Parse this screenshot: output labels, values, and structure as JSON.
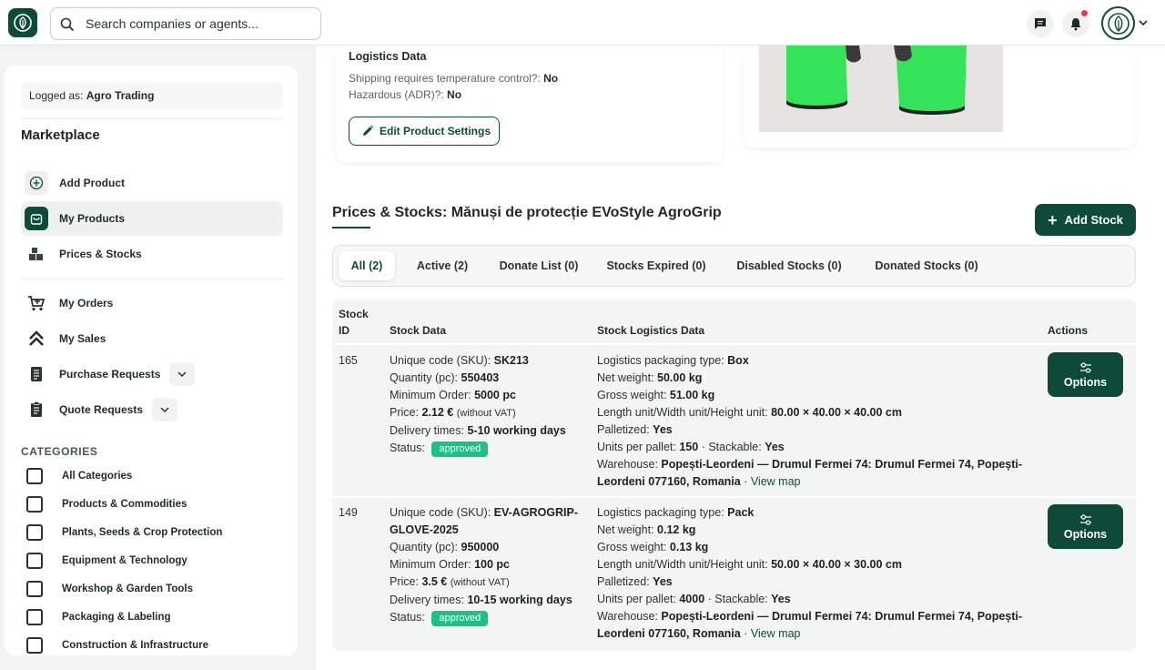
{
  "header": {
    "search_placeholder": "Search companies or agents...",
    "icons": [
      "logo-icon",
      "search-icon",
      "chat-icon",
      "bell-icon",
      "avatar",
      "chevron-down-icon"
    ]
  },
  "sidebar": {
    "logged_label": "Logged as:",
    "logged_company": "Agro Trading",
    "title": "Marketplace",
    "nav": [
      {
        "label": "Add Product",
        "icon": "plus-circle-icon"
      },
      {
        "label": "My Products",
        "icon": "bag-icon",
        "active": true
      },
      {
        "label": "Prices & Stocks",
        "icon": "boxes-icon"
      },
      {
        "label": "My Orders",
        "icon": "cart-icon"
      },
      {
        "label": "My Sales",
        "icon": "chevrons-up-icon"
      },
      {
        "label": "Purchase Requests",
        "icon": "document-icon"
      },
      {
        "label": "Quote Requests",
        "icon": "clipboard-icon"
      }
    ],
    "categories_heading": "CATEGORIES",
    "categories": [
      "All Categories",
      "Products & Commodities",
      "Plants, Seeds & Crop Protection",
      "Equipment & Technology",
      "Workshop & Garden Tools",
      "Packaging & Labeling",
      "Construction & Infrastructure"
    ]
  },
  "logistics": {
    "title": "Logistics Data",
    "temp_label": "Shipping requires temperature control?:",
    "temp_value": "No",
    "hazard_label": "Hazardous (ADR)?:",
    "hazard_value": "No",
    "edit_button": "Edit Product Settings"
  },
  "stocks": {
    "title": "Prices & Stocks: Mănuși de protecție EVoStyle AgroGrip",
    "add_button": "Add Stock",
    "tabs": [
      {
        "label": "All (2)",
        "active": true
      },
      {
        "label": "Active (2)"
      },
      {
        "label": "Donate List (0)"
      },
      {
        "label": "Stocks Expired (0)"
      },
      {
        "label": "Disabled Stocks (0)"
      },
      {
        "label": "Donated Stocks (0)"
      }
    ],
    "columns": {
      "id_1": "Stock",
      "id_2": "ID",
      "data": "Stock Data",
      "logistics": "Stock Logistics Data",
      "actions": "Actions"
    },
    "labels": {
      "sku": "Unique code (SKU):",
      "qty": "Quantity (pc):",
      "min_order": "Minimum Order:",
      "price": "Price:",
      "without_vat": "(without VAT)",
      "delivery": "Delivery times:",
      "status": "Status:",
      "pack_type": "Logistics packaging type:",
      "net": "Net weight:",
      "gross": "Gross weight:",
      "dims": "Length unit/Width unit/Height unit:",
      "palletized": "Palletized:",
      "units_pallet": "Units per pallet:",
      "stackable": "· Stackable:",
      "warehouse": "Warehouse:",
      "view_map": "View map",
      "options": "Options"
    },
    "rows": [
      {
        "id": "165",
        "sku": "SK213",
        "qty": "550403",
        "min_order": "5000 pc",
        "price": "2.12 €",
        "delivery": "5-10 working days",
        "status": "approved",
        "pack_type": "Box",
        "net": "50.00 kg",
        "gross": "51.00 kg",
        "dims": "80.00 × 40.00 × 40.00 cm",
        "palletized": "Yes",
        "units_pallet": "150",
        "stackable": "Yes",
        "warehouse_1": "Popești-Leordeni — Drumul Fermei 74: Drumul Fermei 74, Popești-",
        "warehouse_2": "Leordeni 077160, Romania"
      },
      {
        "id": "149",
        "sku_1": "EV-AGROGRIP-",
        "sku_2": "GLOVE-2025",
        "qty": "950000",
        "min_order": "100 pc",
        "price": "3.5 €",
        "delivery": "10-15 working days",
        "status": "approved",
        "pack_type": "Pack",
        "net": "0.12 kg",
        "gross": "0.13 kg",
        "dims": "50.00 × 40.00 × 30.00 cm",
        "palletized": "Yes",
        "units_pallet": "4000",
        "stackable": "Yes",
        "warehouse_1": "Popești-Leordeni — Drumul Fermei 74: Drumul Fermei 74, Popești-",
        "warehouse_2": "Leordeni 077160, Romania"
      }
    ]
  },
  "colors": {
    "brand": "#0e4a3a",
    "approved": "#1fbf8a",
    "notification": "#e53950",
    "glove": "#35e35a"
  }
}
